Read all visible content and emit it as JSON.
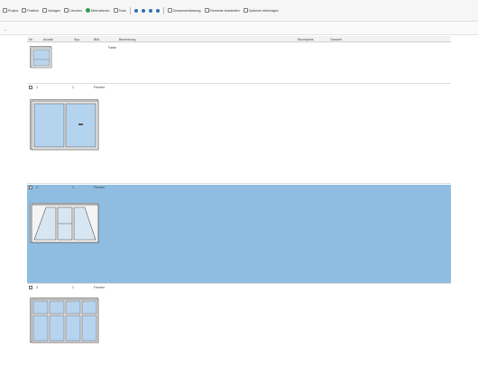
{
  "toolbar": {
    "items": [
      "Project",
      "Position",
      "Vorlagen",
      "Löschen",
      "Übernahmen",
      "Tools"
    ],
    "items2": [
      "Zusammenfassung",
      "Elemente bearbeiten",
      "Optionen übertragen"
    ]
  },
  "columns": [
    "Nr.",
    "Anzahl",
    "Sys.",
    "Bild",
    "Benennung",
    "",
    "Einzelpreis",
    "Gesamt"
  ],
  "positions": [
    {
      "nr": "",
      "count": "",
      "system": "",
      "kind": "",
      "description": "",
      "props": [
        [
          "Farbe",
          ""
        ],
        [
          "",
          ""
        ],
        [
          "",
          ""
        ],
        [
          "",
          ""
        ],
        [
          "",
          ""
        ],
        [
          "",
          ""
        ]
      ]
    },
    {
      "nr": "1",
      "count": "1",
      "system": "",
      "kind": "Fenster",
      "description": "",
      "props": [
        [
          "",
          ""
        ],
        [
          "",
          ""
        ],
        [
          "",
          ""
        ],
        [
          "",
          ""
        ],
        [
          "",
          ""
        ],
        [
          "",
          ""
        ],
        [
          "",
          ""
        ],
        [
          "",
          ""
        ],
        [
          "",
          ""
        ],
        [
          "",
          ""
        ],
        [
          "",
          ""
        ],
        [
          "",
          ""
        ]
      ]
    },
    {
      "nr": "2",
      "count": "1",
      "system": "",
      "kind": "Fenster",
      "description": "",
      "props": [
        [
          "",
          ""
        ],
        [
          "",
          ""
        ],
        [
          "",
          ""
        ],
        [
          "",
          ""
        ],
        [
          "",
          ""
        ],
        [
          "",
          ""
        ],
        [
          "",
          ""
        ],
        [
          "",
          ""
        ],
        [
          "",
          ""
        ],
        [
          "",
          ""
        ],
        [
          "",
          ""
        ],
        [
          "",
          ""
        ],
        [
          "",
          ""
        ]
      ]
    },
    {
      "nr": "3",
      "count": "1",
      "system": "",
      "kind": "Fenster",
      "description": "",
      "props": [
        [
          "",
          ""
        ],
        [
          "",
          ""
        ],
        [
          "",
          ""
        ],
        [
          "",
          ""
        ],
        [
          "",
          ""
        ],
        [
          "",
          ""
        ],
        [
          "",
          ""
        ],
        [
          "",
          ""
        ],
        [
          "",
          ""
        ],
        [
          "",
          ""
        ],
        [
          "",
          ""
        ],
        [
          "",
          ""
        ],
        [
          "",
          ""
        ]
      ]
    }
  ]
}
